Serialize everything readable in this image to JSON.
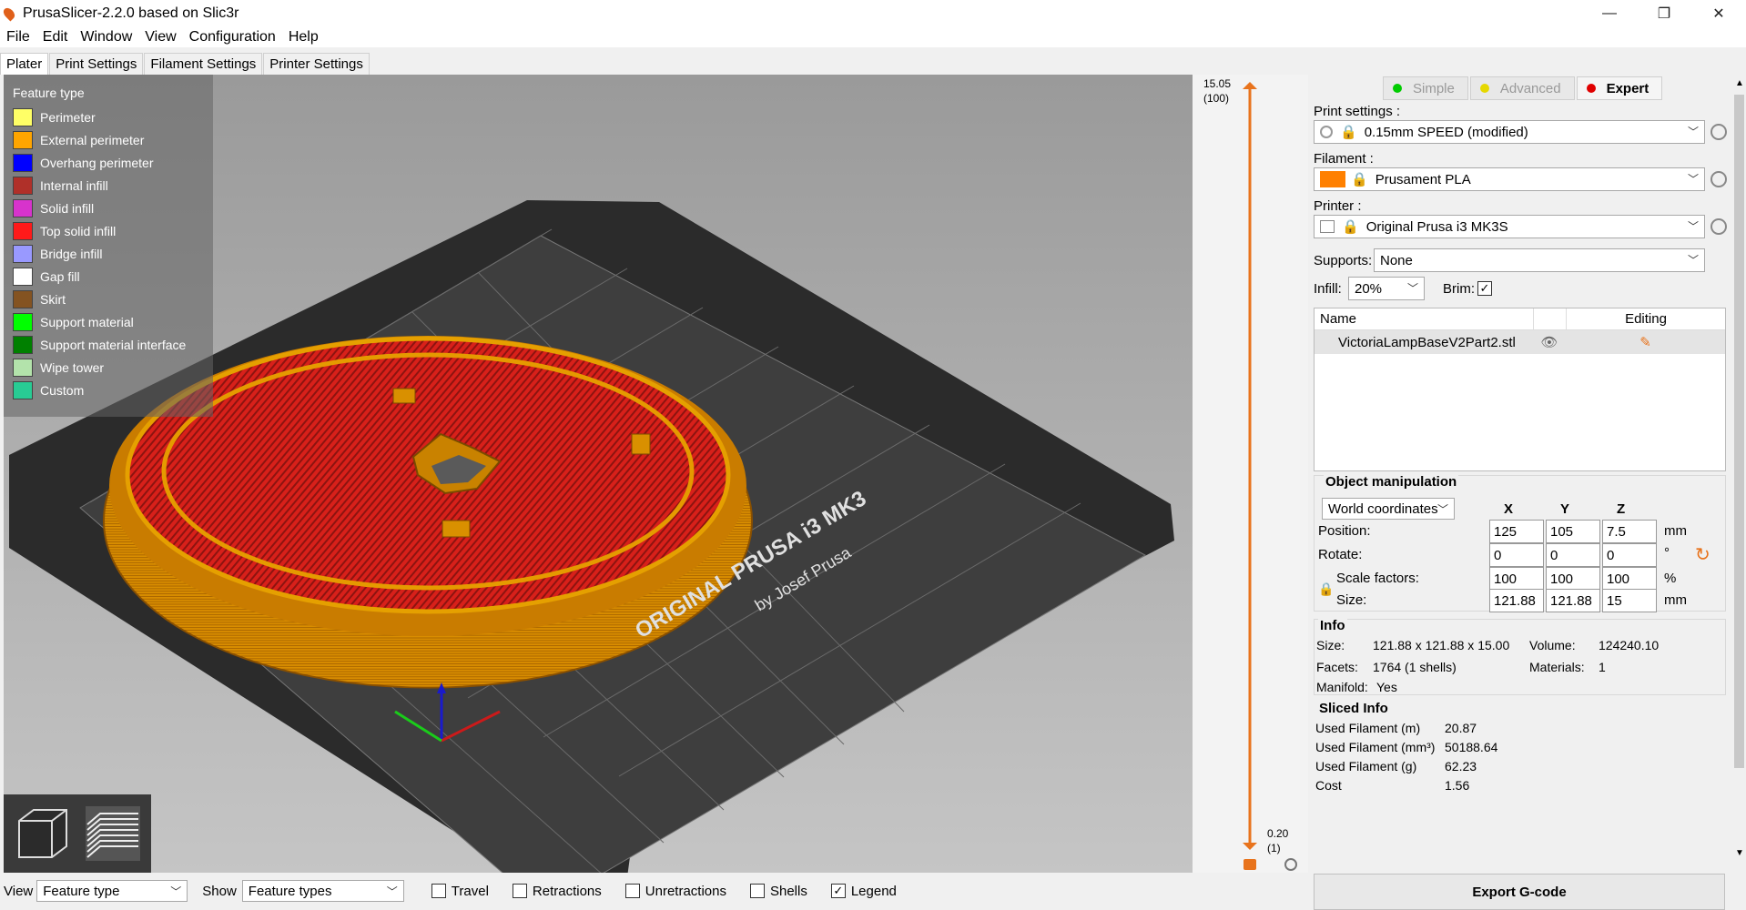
{
  "window": {
    "title": "PrusaSlicer-2.2.0 based on Slic3r",
    "minimize": "—",
    "maximize": "❐",
    "close": "✕"
  },
  "menu": [
    "File",
    "Edit",
    "Window",
    "View",
    "Configuration",
    "Help"
  ],
  "tabs": [
    "Plater",
    "Print Settings",
    "Filament Settings",
    "Printer Settings"
  ],
  "legend": {
    "title": "Feature type",
    "items": [
      {
        "label": "Perimeter",
        "color": "#ffff66"
      },
      {
        "label": "External perimeter",
        "color": "#ffa500"
      },
      {
        "label": "Overhang perimeter",
        "color": "#0000ff"
      },
      {
        "label": "Internal infill",
        "color": "#b03029"
      },
      {
        "label": "Solid infill",
        "color": "#d733cc"
      },
      {
        "label": "Top solid infill",
        "color": "#ff1a1a"
      },
      {
        "label": "Bridge infill",
        "color": "#9999ff"
      },
      {
        "label": "Gap fill",
        "color": "#ffffff"
      },
      {
        "label": "Skirt",
        "color": "#845321"
      },
      {
        "label": "Support material",
        "color": "#00ff00"
      },
      {
        "label": "Support material interface",
        "color": "#008000"
      },
      {
        "label": "Wipe tower",
        "color": "#b3e3ab"
      },
      {
        "label": "Custom",
        "color": "#28cc94"
      }
    ]
  },
  "bed": {
    "brand": "ORIGINAL PRUSA i3 MK3",
    "byline": "by Josef Prusa"
  },
  "layer_slider": {
    "top_height": "15.05",
    "top_layer": "(100)",
    "bottom_height": "0.20",
    "bottom_layer": "(1)"
  },
  "modes": [
    {
      "label": "Simple",
      "color": "#00cc00",
      "active": false
    },
    {
      "label": "Advanced",
      "color": "#e6d800",
      "active": false
    },
    {
      "label": "Expert",
      "color": "#e00000",
      "active": true
    }
  ],
  "print_settings": {
    "label": "Print settings :",
    "value": "0.15mm SPEED (modified)"
  },
  "filament": {
    "label": "Filament :",
    "value": "Prusament PLA",
    "color": "#ff8000"
  },
  "printer": {
    "label": "Printer :",
    "value": "Original Prusa i3 MK3S"
  },
  "supports": {
    "label": "Supports:",
    "value": "None"
  },
  "infill": {
    "label": "Infill:",
    "value": "20%"
  },
  "brim": {
    "label": "Brim:",
    "checked": "✓"
  },
  "object_list": {
    "col_name": "Name",
    "col_editing": "Editing",
    "objects": [
      {
        "name": "VictoriaLampBaseV2Part2.stl"
      }
    ]
  },
  "manipulation": {
    "title": "Object manipulation",
    "coords": "World coordinates",
    "x": "X",
    "y": "Y",
    "z": "Z",
    "position_label": "Position:",
    "position": [
      "125",
      "105",
      "7.5"
    ],
    "position_unit": "mm",
    "rotate_label": "Rotate:",
    "rotate": [
      "0",
      "0",
      "0"
    ],
    "rotate_unit": "°",
    "scale_label": "Scale factors:",
    "scale": [
      "100",
      "100",
      "100"
    ],
    "scale_unit": "%",
    "size_label": "Size:",
    "size": [
      "121.88",
      "121.88",
      "15"
    ],
    "size_unit": "mm"
  },
  "info": {
    "title": "Info",
    "size_label": "Size:",
    "size": "121.88 x 121.88 x 15.00",
    "volume_label": "Volume:",
    "volume": "124240.10",
    "facets_label": "Facets:",
    "facets": "1764 (1 shells)",
    "materials_label": "Materials:",
    "materials": "1",
    "manifold_label": "Manifold:",
    "manifold": "Yes"
  },
  "sliced_info": {
    "title": "Sliced Info",
    "rows": [
      {
        "label": "Used Filament (m)",
        "value": "20.87"
      },
      {
        "label": "Used Filament (mm³)",
        "value": "50188.64"
      },
      {
        "label": "Used Filament (g)",
        "value": "62.23"
      },
      {
        "label": "Cost",
        "value": "1.56"
      }
    ]
  },
  "export_button": "Export G-code",
  "bottom": {
    "view_label": "View",
    "view_value": "Feature type",
    "show_label": "Show",
    "show_value": "Feature types",
    "checks": [
      {
        "label": "Travel",
        "mark": ""
      },
      {
        "label": "Retractions",
        "mark": ""
      },
      {
        "label": "Unretractions",
        "mark": ""
      },
      {
        "label": "Shells",
        "mark": ""
      },
      {
        "label": "Legend",
        "mark": "✓"
      }
    ]
  }
}
